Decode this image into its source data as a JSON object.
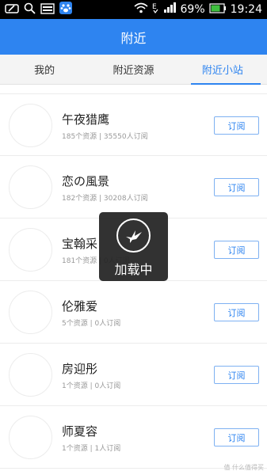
{
  "status_bar": {
    "battery": "69%",
    "time": "19:24",
    "icons_left": [
      "edit-icon",
      "search-icon",
      "image-icon",
      "baidu-paw-icon"
    ],
    "icons_right": [
      "wifi-icon",
      "data-e-icon",
      "signal-icon",
      "battery-icon"
    ]
  },
  "header": {
    "title": "附近"
  },
  "tabs": [
    {
      "label": "我的"
    },
    {
      "label": "附近资源"
    },
    {
      "label": "附近小站",
      "active": true
    }
  ],
  "list": [
    {
      "name": "午夜猎鹰",
      "meta": "185个资源 | 35550人订阅",
      "button": "订阅"
    },
    {
      "name": "恋の風景",
      "meta": "182个资源 | 30208人订阅",
      "button": "订阅"
    },
    {
      "name": "宝翰采",
      "meta": "181个资源 | 0人订阅",
      "button": "订阅"
    },
    {
      "name": "伦雅爱",
      "meta": "5个资源 | 0人订阅",
      "button": "订阅"
    },
    {
      "name": "房迎彤",
      "meta": "1个资源 | 0人订阅",
      "button": "订阅"
    },
    {
      "name": "师夏容",
      "meta": "1个资源 | 1人订阅",
      "button": "订阅"
    }
  ],
  "loading": {
    "text": "加载中",
    "icon": "bird-icon"
  },
  "watermark": "值 什么值得买",
  "colors": {
    "accent": "#2e84f0",
    "statusbar": "#000000",
    "battery_fill": "#3fbf3f"
  }
}
